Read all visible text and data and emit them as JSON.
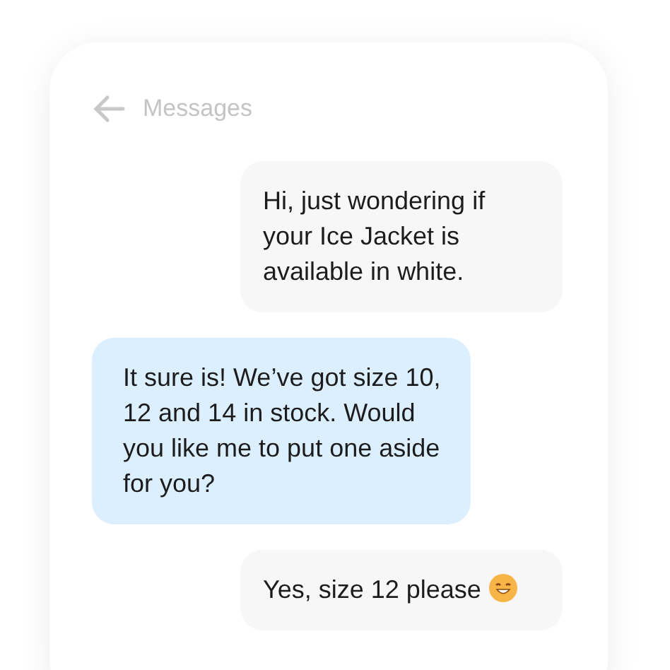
{
  "header": {
    "title": "Messages"
  },
  "messages": [
    {
      "kind": "sent",
      "text": "Hi, just wondering if your Ice Jacket is available in white.",
      "emoji": false
    },
    {
      "kind": "received",
      "text": "It sure is! We’ve got size 10, 12 and 14 in stock. Would you like me to put one aside for you?",
      "emoji": false
    },
    {
      "kind": "sent",
      "text": "Yes, size 12 please",
      "emoji": true
    }
  ]
}
